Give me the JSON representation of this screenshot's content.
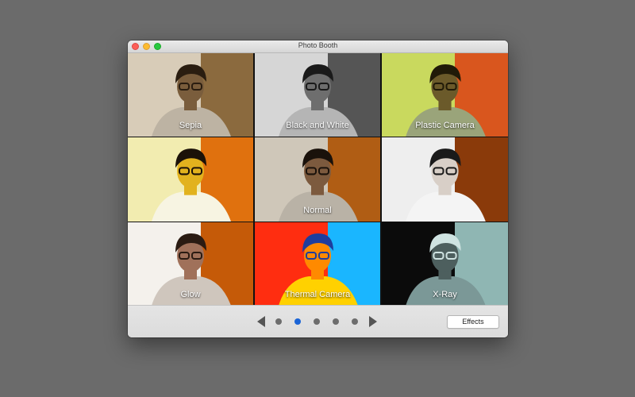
{
  "window": {
    "title": "Photo Booth"
  },
  "effects": [
    {
      "label": "Sepia",
      "bg": "#d8ccb8",
      "accent": "#8b6a3e",
      "skin": "#7a5d3c",
      "hair": "#2a1d10",
      "shirt": "#bdb3a3"
    },
    {
      "label": "Black and White",
      "bg": "#d6d6d6",
      "accent": "#555555",
      "skin": "#6e6e6e",
      "hair": "#1a1a1a",
      "shirt": "#b5b5b5"
    },
    {
      "label": "Plastic Camera",
      "bg": "#c9d95e",
      "accent": "#d9561e",
      "skin": "#6b5a2a",
      "hair": "#201a08",
      "shirt": "#9aa47a"
    },
    {
      "label": "",
      "bg": "#f2ecb0",
      "accent": "#e0710e",
      "skin": "#e2b21e",
      "hair": "#1c1208",
      "shirt": "#f7f4e2"
    },
    {
      "label": "Normal",
      "bg": "#cfc7b9",
      "accent": "#b05d14",
      "skin": "#7c5a3e",
      "hair": "#1a120b",
      "shirt": "#b9b2a6"
    },
    {
      "label": "",
      "bg": "#eeeeee",
      "accent": "#8a3a0a",
      "skin": "#d8cfc7",
      "hair": "#1a1a1a",
      "shirt": "#f4f4f4"
    },
    {
      "label": "Glow",
      "bg": "#f4f1ec",
      "accent": "#c55a08",
      "skin": "#a0715a",
      "hair": "#2a1b12",
      "shirt": "#cfc6bd"
    },
    {
      "label": "Thermal Camera",
      "bg": "#ff2d10",
      "accent": "#1ab6ff",
      "skin": "#ff8a00",
      "hair": "#1e3d9e",
      "shirt": "#ffd100"
    },
    {
      "label": "X-Ray",
      "bg": "#0b0b0b",
      "accent": "#8fb6b3",
      "skin": "#4d5f5e",
      "hair": "#cfe3e1",
      "shirt": "#7b9897"
    }
  ],
  "navigation": {
    "prev_icon": "triangle-left-icon",
    "next_icon": "triangle-right-icon",
    "pages": 5,
    "active_page": 2
  },
  "effects_button": {
    "label": "Effects"
  }
}
